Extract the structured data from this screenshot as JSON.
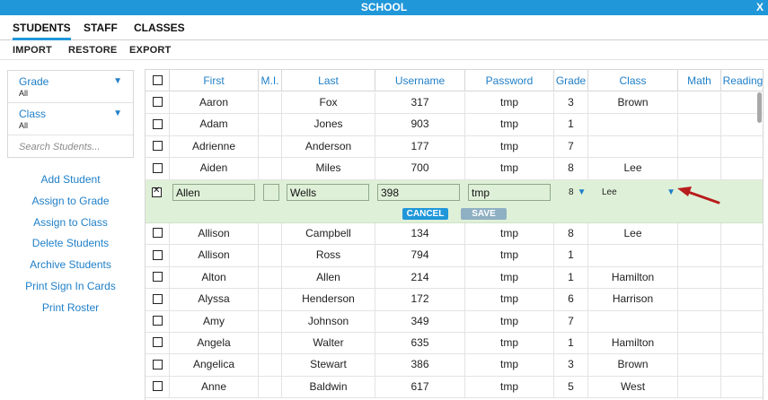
{
  "window": {
    "title": "SCHOOL",
    "close_label": "X"
  },
  "tabs": [
    {
      "label": "STUDENTS",
      "active": true
    },
    {
      "label": "STAFF",
      "active": false
    },
    {
      "label": "CLASSES",
      "active": false
    }
  ],
  "subtabs": [
    "IMPORT",
    "RESTORE",
    "EXPORT"
  ],
  "filters": [
    {
      "label": "Grade",
      "value": "All"
    },
    {
      "label": "Class",
      "value": "All"
    }
  ],
  "search": {
    "placeholder": "Search Students..."
  },
  "actions": [
    "Add Student",
    "Assign to Grade",
    "Assign to Class",
    "Delete Students",
    "Archive Students",
    "Print Sign In Cards",
    "Print Roster"
  ],
  "table": {
    "columns": [
      "First",
      "M.I.",
      "Last",
      "Username",
      "Password",
      "Grade",
      "Class",
      "Math",
      "Reading"
    ],
    "rows_above": [
      {
        "first": "Aaron",
        "mi": "",
        "last": "Fox",
        "username": "317",
        "password": "tmp",
        "grade": "3",
        "class": "Brown"
      },
      {
        "first": "Adam",
        "mi": "",
        "last": "Jones",
        "username": "903",
        "password": "tmp",
        "grade": "1",
        "class": ""
      },
      {
        "first": "Adrienne",
        "mi": "",
        "last": "Anderson",
        "username": "177",
        "password": "tmp",
        "grade": "7",
        "class": ""
      },
      {
        "first": "Aiden",
        "mi": "",
        "last": "Miles",
        "username": "700",
        "password": "tmp",
        "grade": "8",
        "class": "Lee"
      }
    ],
    "edit_row": {
      "first": "Allen",
      "mi": "",
      "last": "Wells",
      "username": "398",
      "password": "tmp",
      "grade": "8",
      "class": "Lee",
      "cancel_label": "CANCEL",
      "save_label": "SAVE",
      "caret": "▼"
    },
    "rows_below": [
      {
        "first": "Allison",
        "mi": "",
        "last": "Campbell",
        "username": "134",
        "password": "tmp",
        "grade": "8",
        "class": "Lee"
      },
      {
        "first": "Allison",
        "mi": "",
        "last": "Ross",
        "username": "794",
        "password": "tmp",
        "grade": "1",
        "class": ""
      },
      {
        "first": "Alton",
        "mi": "",
        "last": "Allen",
        "username": "214",
        "password": "tmp",
        "grade": "1",
        "class": "Hamilton"
      },
      {
        "first": "Alyssa",
        "mi": "",
        "last": "Henderson",
        "username": "172",
        "password": "tmp",
        "grade": "6",
        "class": "Harrison"
      },
      {
        "first": "Amy",
        "mi": "",
        "last": "Johnson",
        "username": "349",
        "password": "tmp",
        "grade": "7",
        "class": ""
      },
      {
        "first": "Angela",
        "mi": "",
        "last": "Walter",
        "username": "635",
        "password": "tmp",
        "grade": "1",
        "class": "Hamilton"
      },
      {
        "first": "Angelica",
        "mi": "",
        "last": "Stewart",
        "username": "386",
        "password": "tmp",
        "grade": "3",
        "class": "Brown"
      },
      {
        "first": "Anne",
        "mi": "",
        "last": "Baldwin",
        "username": "617",
        "password": "tmp",
        "grade": "5",
        "class": "West"
      }
    ]
  },
  "colors": {
    "accent": "#1f97d9",
    "link": "#1f7fc8",
    "edit_bg": "#dff0d8",
    "arrow": "#b81c1c"
  }
}
